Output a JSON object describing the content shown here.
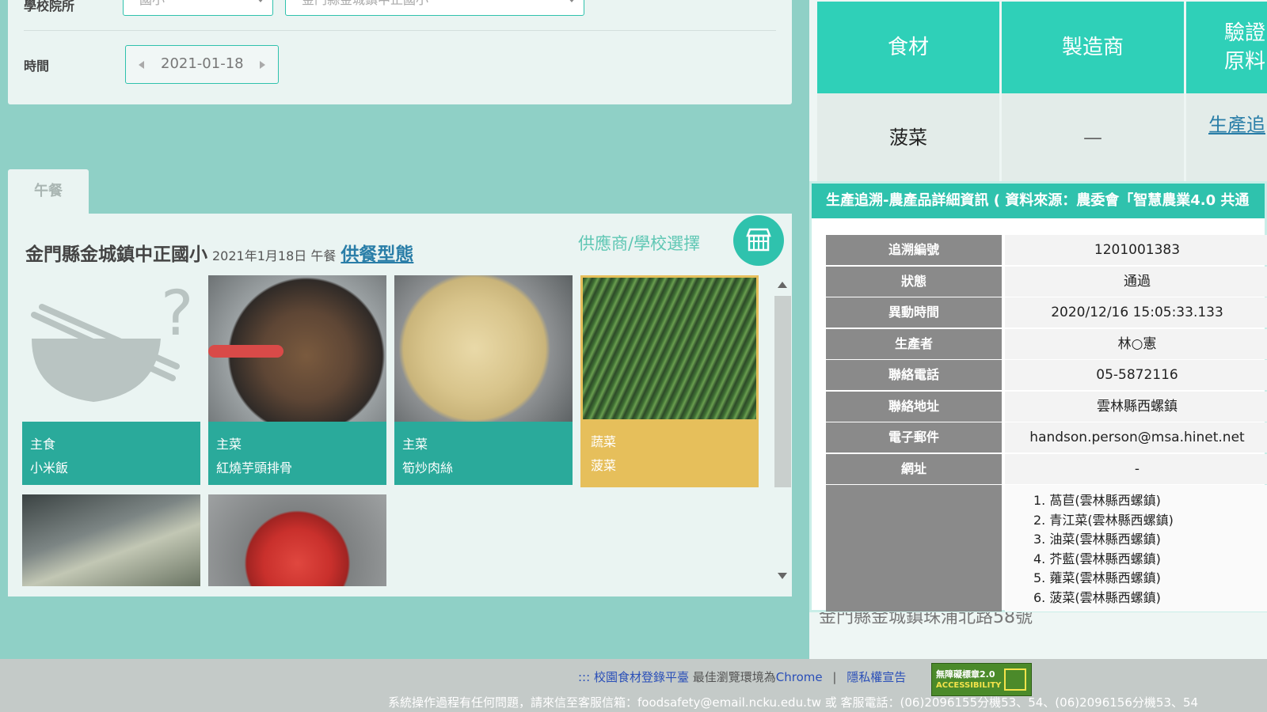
{
  "filters": {
    "school_type_label": "學校院所",
    "school_type_value": "國小",
    "school_value": "金門縣金城鎮中正國小",
    "time_label": "時間",
    "date_value": "2021-01-18"
  },
  "meal": {
    "tab_label": "午餐",
    "school_name": "金門縣金城鎮中正國小",
    "date_text": "2021年1月18日 午餐",
    "type_link": "供餐型態",
    "supplier_label": "供應商/學校選擇",
    "dishes": [
      {
        "category": "主食",
        "name": "小米飯",
        "highlight": false
      },
      {
        "category": "主菜",
        "name": "紅燒芋頭排骨",
        "highlight": false
      },
      {
        "category": "主菜",
        "name": "筍炒肉絲",
        "highlight": false
      },
      {
        "category": "蔬菜",
        "name": "菠菜",
        "highlight": true
      }
    ]
  },
  "ingredients": {
    "headers": [
      "食材",
      "製造商",
      "驗證",
      "原料"
    ],
    "row": {
      "name": "菠菜",
      "manufacturer": "—",
      "link": "生產追"
    },
    "partial_address": "金門縣金城鎮珠浦北路58號"
  },
  "trace": {
    "title": "生產追溯-農產品詳細資訊 ( 資料來源：農委會「智慧農業4.0 共通",
    "rows": [
      {
        "key": "追溯編號",
        "value": "1201001383"
      },
      {
        "key": "狀態",
        "value": "通過"
      },
      {
        "key": "異動時間",
        "value": "2020/12/16 15:05:33.133"
      },
      {
        "key": "生產者",
        "value": "林○憲"
      },
      {
        "key": "聯絡電話",
        "value": "05-5872116"
      },
      {
        "key": "聯絡地址",
        "value": "雲林縣西螺鎮"
      },
      {
        "key": "電子郵件",
        "value": "handson.person@msa.hinet.net"
      },
      {
        "key": "網址",
        "value": "-"
      }
    ],
    "products": [
      "1. 萵苣(雲林縣西螺鎮)",
      "2. 青江菜(雲林縣西螺鎮)",
      "3. 油菜(雲林縣西螺鎮)",
      "4. 芥藍(雲林縣西螺鎮)",
      "5. 蕹菜(雲林縣西螺鎮)",
      "6. 菠菜(雲林縣西螺鎮)"
    ]
  },
  "footer": {
    "prefix": ":::",
    "site_link": "校園食材登錄平臺",
    "browser_text": "最佳瀏覽環境為",
    "browser_link": "Chrome",
    "separator": "|",
    "privacy_link": "隱私權宣告",
    "badge_line1": "無障礙標章2.0",
    "badge_line2": "ACCESSIBILITY",
    "info": "系統操作過程有任何問題，請來信至客服信箱：foodsafety@email.ncku.edu.tw 或 客服電話：(06)2096155分機53、54、(06)2096156分機53、54"
  },
  "colors": {
    "background": "#8fd0c6",
    "accent": "#2fc2ad",
    "caption_teal": "#2aaa9b",
    "caption_gold": "#e6bf5b"
  }
}
